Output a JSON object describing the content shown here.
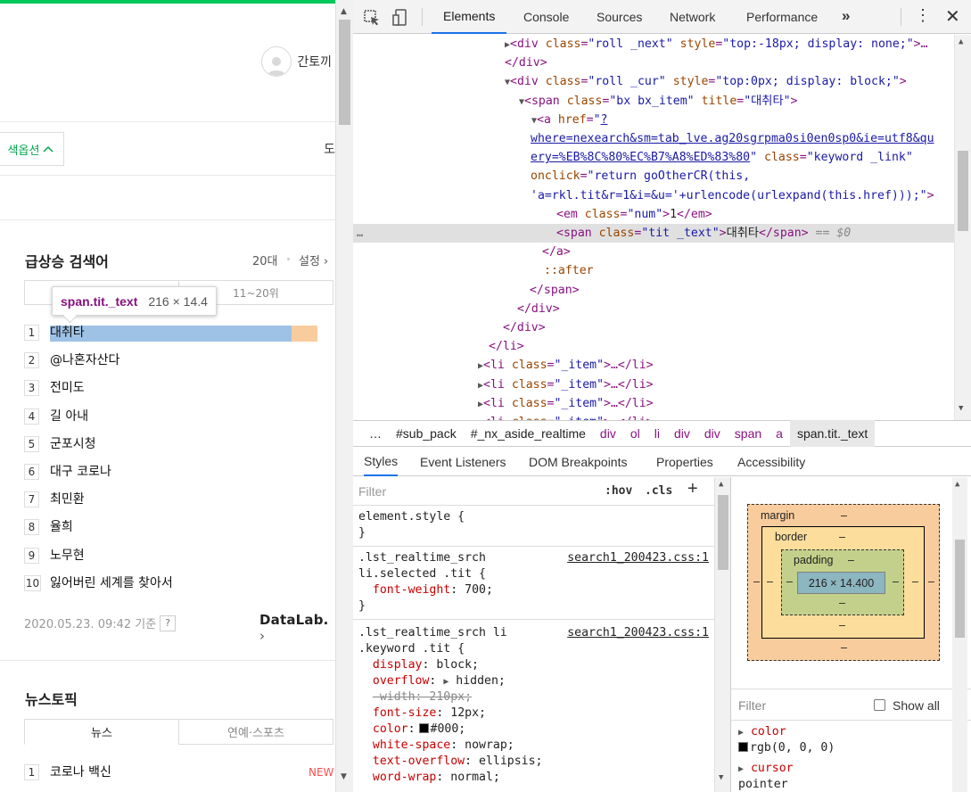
{
  "page": {
    "user_name": "간토끼",
    "search_option": "색옵션",
    "tool_label": "도",
    "realtime": {
      "title": "급상승 검색어",
      "age": "20대",
      "setting": "설정",
      "tab_right": "11~20위",
      "items": [
        {
          "rank": "1",
          "keyword": "대취타"
        },
        {
          "rank": "2",
          "keyword": "@나혼자산다"
        },
        {
          "rank": "3",
          "keyword": "전미도"
        },
        {
          "rank": "4",
          "keyword": "길 아내"
        },
        {
          "rank": "5",
          "keyword": "군포시청"
        },
        {
          "rank": "6",
          "keyword": "대구 코로나"
        },
        {
          "rank": "7",
          "keyword": "최민환"
        },
        {
          "rank": "8",
          "keyword": "율희"
        },
        {
          "rank": "9",
          "keyword": "노무현"
        },
        {
          "rank": "10",
          "keyword": "잃어버린 세계를 찾아서"
        }
      ],
      "date": "2020.05.23. 09:42 기준",
      "help": "?",
      "datalab": "DataLab."
    },
    "news": {
      "title": "뉴스토픽",
      "tab_news": "뉴스",
      "tab_ent": "연예·스포츠",
      "first_rank": "1",
      "first_item": "코로나 백신",
      "new_badge": "NEW"
    }
  },
  "tooltip": {
    "selector": "span.tit._text",
    "size": "216 × 14.4"
  },
  "devtools": {
    "tabs": [
      "Elements",
      "Console",
      "Sources",
      "Network",
      "Performance"
    ],
    "more": "»",
    "dom": {
      "l1_tag_open": "<div",
      "l1_attr1": "class",
      "l1_val1": "\"roll _next\"",
      "l1_attr2": "style",
      "l1_val2": "\"top:-18px; display: none;\"",
      "l1_tail": ">…",
      "l2": "</div>",
      "l3_attr1": "class",
      "l3_val1": "\"roll _cur\"",
      "l3_attr2": "style",
      "l3_val2": "\"top:0px; display: block;\"",
      "l4_val1": "\"bx bx_item\"",
      "l4_attr2": "title",
      "l4_val2": "\"대취타\"",
      "l5_href_start": "?",
      "l6_href": "where=nexearch&sm=tab_lve.ag20sgrpma0si0en0sp0&ie=utf8&qu",
      "l7_href": "ery=%EB%8C%80%EC%B7%A8%ED%83%80",
      "l7_class": "\"keyword _link\"",
      "l8_onclick": "\"return goOtherCR(this,",
      "l9_onclick": "'a=rkl.tit&r=1&i=&u='+urlencode(urlexpand(this.href)));\"",
      "l10_class": "\"num\"",
      "l10_text": "1",
      "l11_class": "\"tit _text\"",
      "l11_text": "대취타",
      "l11_eq": "== $0",
      "l12": "</a>",
      "l13": "::after",
      "l14": "</span>",
      "l15": "</div>",
      "l16": "</div>",
      "l17": "</li>",
      "li_class": "\"_item\"",
      "li_tail": ">…</li>",
      "dots": "…"
    },
    "breadcrumbs": [
      "…",
      "#sub_pack",
      "#_nx_aside_realtime",
      "div",
      "ol",
      "li",
      "div",
      "div",
      "span",
      "a",
      "span.tit._text"
    ],
    "sub_tabs": [
      "Styles",
      "Event Listeners",
      "DOM Breakpoints",
      "Properties",
      "Accessibility"
    ],
    "styles": {
      "filter_placeholder": "Filter",
      "hov": ":hov",
      "cls": ".cls",
      "plus": "+",
      "element_style": "element.style {",
      "close": "}",
      "rule1_sel1": ".lst_realtime_srch",
      "rule1_sel2": "li.selected .tit {",
      "rule1_src": "search1_200423.css:1",
      "rule1_prop": "font-weight",
      "rule1_val": "700;",
      "rule2_sel1": ".lst_realtime_srch li",
      "rule2_sel2": ".keyword .tit {",
      "rule2_src": "search1_200423.css:1",
      "props": [
        {
          "name": "display",
          "value": "block;"
        },
        {
          "name": "overflow",
          "value": "hidden;"
        },
        {
          "name": "-width: 210px;",
          "value": ""
        },
        {
          "name": "font-size",
          "value": "12px;"
        },
        {
          "name": "color",
          "value": "#000;"
        },
        {
          "name": "white-space",
          "value": "nowrap;"
        },
        {
          "name": "text-overflow",
          "value": "ellipsis;"
        },
        {
          "name": "word-wrap",
          "value": "normal;"
        }
      ]
    },
    "computed": {
      "margin": "margin",
      "border": "border",
      "padding": "padding",
      "dash": "–",
      "content_size": "216 × 14.400",
      "filter": "Filter",
      "show_all": "Show all",
      "prop1_name": "color",
      "prop1_val": "rgb(0, 0, 0)",
      "prop2_name": "cursor",
      "prop2_val": "pointer"
    }
  }
}
